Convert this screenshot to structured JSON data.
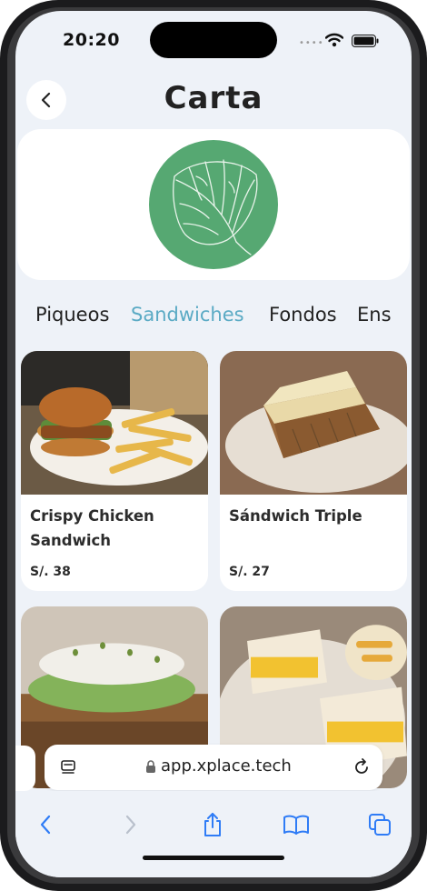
{
  "status_bar": {
    "time": "20:20",
    "signal_dots": "••••"
  },
  "header": {
    "title": "Carta",
    "back_icon": "chevron-left-icon"
  },
  "hero": {
    "logo_icon": "monstera-leaf-icon",
    "logo_color": "#56a872"
  },
  "tabs": [
    {
      "label": "Piqueos",
      "active": false
    },
    {
      "label": "Sandwiches",
      "active": true
    },
    {
      "label": "Fondos",
      "active": false
    },
    {
      "label": "Ens",
      "active": false
    }
  ],
  "products": [
    {
      "name": "Crispy Chicken Sandwich",
      "price": "S/. 38"
    },
    {
      "name": "Sándwich Triple",
      "price": "S/. 27"
    },
    {
      "name": "",
      "price": ""
    },
    {
      "name": "",
      "price": ""
    }
  ],
  "browser": {
    "url": "app.xplace.tech",
    "icons": [
      "reader-mode-icon",
      "lock-icon",
      "reload-icon"
    ]
  },
  "toolbar": {
    "icons": [
      "back-arrow-icon",
      "forward-arrow-icon",
      "share-icon",
      "bookmarks-icon",
      "tabs-icon"
    ]
  },
  "colors": {
    "accent": "#5aaac4",
    "background": "#eef2f8",
    "ios_blue": "#2f7cf6"
  }
}
